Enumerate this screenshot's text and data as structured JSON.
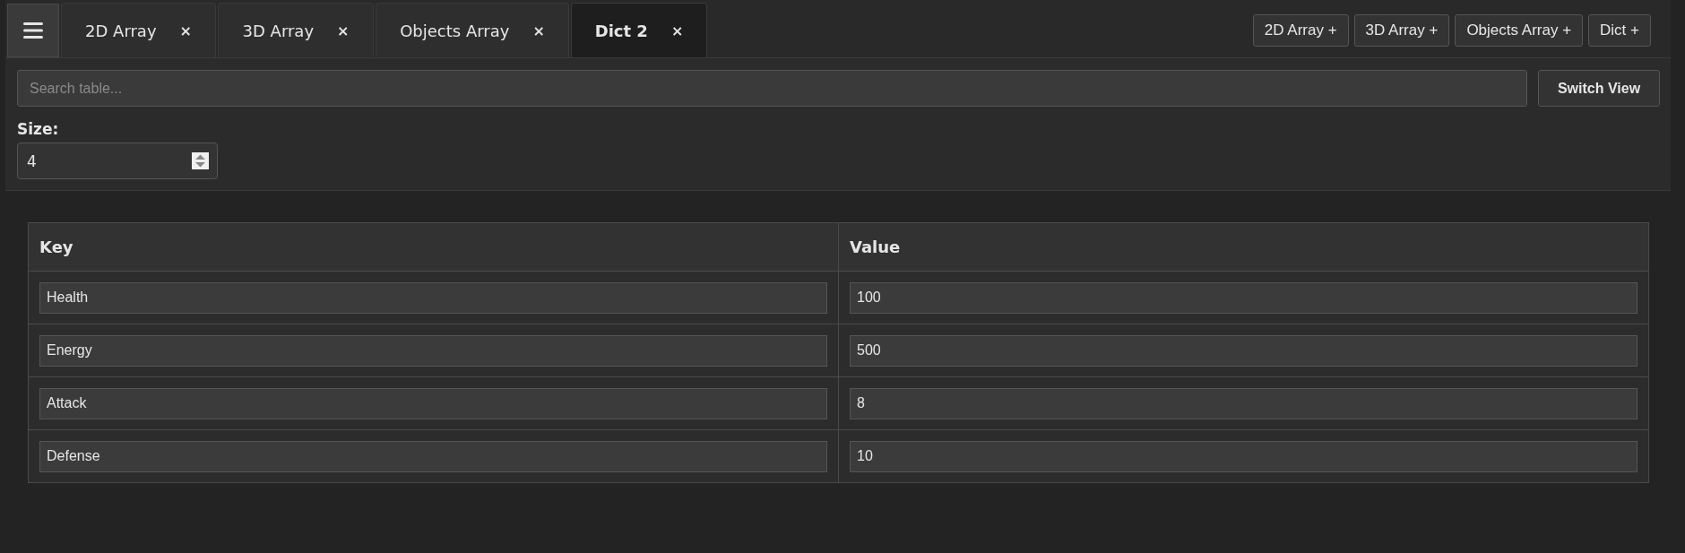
{
  "tabs": [
    {
      "label": "2D Array",
      "close": "×",
      "selected": false
    },
    {
      "label": "3D Array",
      "close": "×",
      "selected": false
    },
    {
      "label": "Objects Array",
      "close": "×",
      "selected": false
    },
    {
      "label": "Dict 2",
      "close": "×",
      "selected": true
    }
  ],
  "add_buttons": [
    "2D Array +",
    "3D Array +",
    "Objects Array +",
    "Dict +"
  ],
  "search": {
    "placeholder": "Search table..."
  },
  "switch_button": "Switch View",
  "size": {
    "label": "Size:",
    "value": "4"
  },
  "table": {
    "columns": [
      "Key",
      "Value"
    ],
    "rows": [
      [
        "Health",
        "100"
      ],
      [
        "Energy",
        "500"
      ],
      [
        "Attack",
        "8"
      ],
      [
        "Defense",
        "10"
      ]
    ]
  }
}
